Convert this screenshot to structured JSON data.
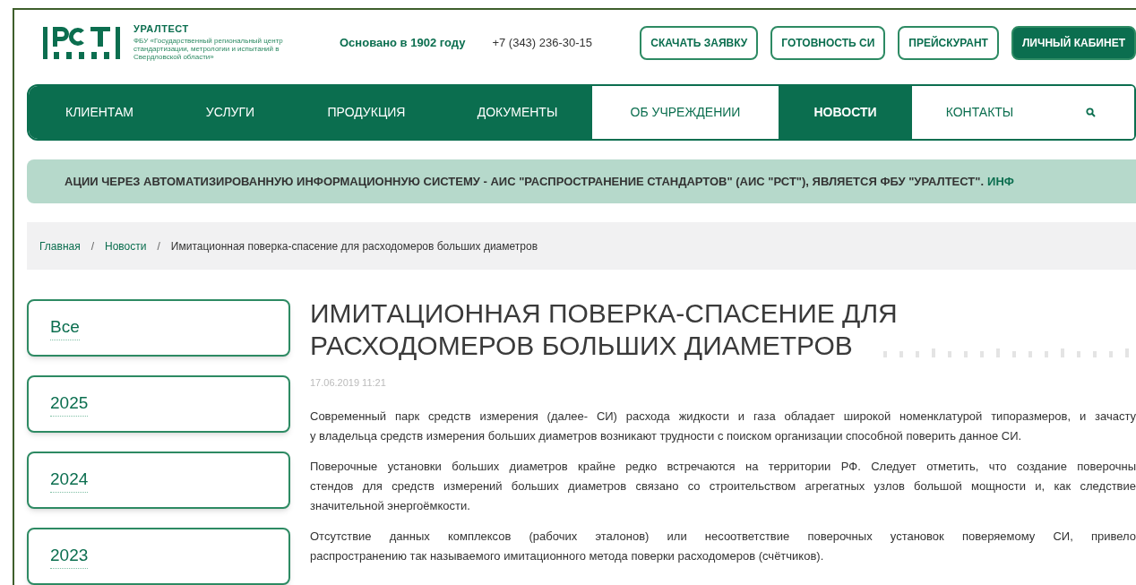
{
  "header": {
    "brand": "УРАЛТЕСТ",
    "brand_subtitle": "ФБУ «Государственный региональный центр стандартизации, метрологии и испытаний в Свердловской области»",
    "founded": "Основано в 1902 году",
    "phone": "+7 (343) 236-30-15",
    "buttons": [
      {
        "label": "СКАЧАТЬ ЗАЯВКУ",
        "kind": "outlined"
      },
      {
        "label": "ГОТОВНОСТЬ СИ",
        "kind": "outlined"
      },
      {
        "label": "ПРЕЙСКУРАНТ",
        "kind": "outlined"
      },
      {
        "label": "ЛИЧНЫЙ КАБИНЕТ",
        "kind": "filled"
      }
    ]
  },
  "nav": {
    "items": [
      {
        "label": "КЛИЕНТАМ",
        "kind": "filled",
        "selected": false
      },
      {
        "label": "УСЛУГИ",
        "kind": "filled",
        "selected": false
      },
      {
        "label": "ПРОДУКЦИЯ",
        "kind": "filled",
        "selected": false
      },
      {
        "label": "ДОКУМЕНТЫ",
        "kind": "filled",
        "selected": false
      },
      {
        "label": "ОБ УЧРЕЖДЕНИИ",
        "kind": "plain",
        "selected": false
      },
      {
        "label": "НОВОСТИ",
        "kind": "filled",
        "selected": true
      },
      {
        "label": "КОНТАКТЫ",
        "kind": "plain",
        "selected": false
      }
    ]
  },
  "ticker": {
    "text": "АЦИИ ЧЕРЕЗ АВТОМАТИЗИРОВАННУЮ ИНФОРМАЦИОННУЮ СИСТЕМУ - АИС \"РАСПРОСТРАНЕНИЕ СТАНДАРТОВ\" (АИС \"РСТ\"), ЯВЛЯЕТСЯ ФБУ \"УРАЛТЕСТ\".",
    "link": "ИНФ"
  },
  "breadcrumbs": [
    {
      "label": "Главная",
      "kind": "link"
    },
    {
      "label": "/",
      "kind": "separator"
    },
    {
      "label": "Новости",
      "kind": "link"
    },
    {
      "label": "/",
      "kind": "separator"
    },
    {
      "label": "Имитационная поверка-спасение для расходомеров больших диаметров",
      "kind": "current"
    }
  ],
  "sidebar": {
    "items": [
      {
        "label": "Все"
      },
      {
        "label": "2025"
      },
      {
        "label": "2024"
      },
      {
        "label": "2023"
      }
    ]
  },
  "article": {
    "title": "ИМИТАЦИОННАЯ ПОВЕРКА-СПАСЕНИЕ ДЛЯ РАСХОДОМЕРОВ БОЛЬШИХ ДИАМЕТРОВ",
    "date": "17.06.2019 11:21",
    "paragraphs": [
      [
        "Современный парк средств измерения (далее- СИ) расхода жидкости и газа обладает широкой номенклатурой типоразмеров, и зачасту",
        "у владельца средств измерения больших диаметров возникают трудности с поиском организации способной поверить данное СИ."
      ],
      [
        "Поверочные установки больших диаметров крайне редко встречаются на территории РФ. Следует отметить, что создание поверочны",
        "стендов для средств измерений больших диаметров связано со строительством агрегатных узлов большой мощности и, как следствие",
        "значительной энергоёмкости."
      ],
      [
        "Отсутствие данных комплексов (рабочих эталонов) или несоответствие поверочных установок поверяемому СИ, привело",
        "распространению так называемого имитационного метода поверки расходомеров (счётчиков)."
      ]
    ]
  }
}
